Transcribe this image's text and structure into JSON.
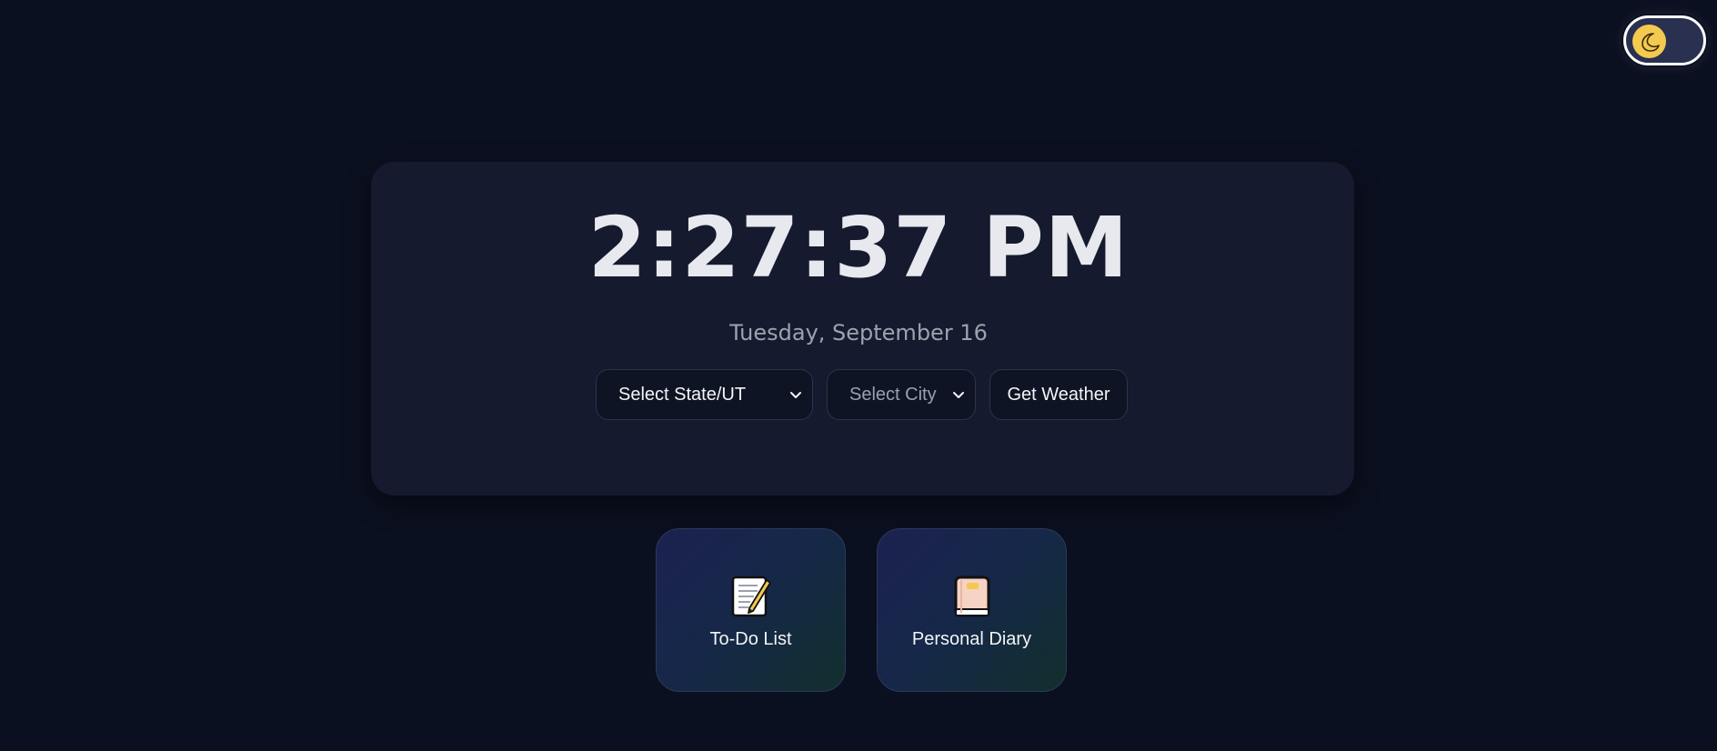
{
  "theme_toggle": {
    "icon": "moon-icon",
    "knob_color": "#f4c950",
    "state": "dark"
  },
  "clock": {
    "time": "2:27:37 PM",
    "date": "Tuesday, September 16"
  },
  "weather": {
    "state_select": {
      "value": "Select State/UT"
    },
    "city_select": {
      "value": "Select City"
    },
    "button_label": "Get Weather"
  },
  "apps": [
    {
      "label": "To-Do List",
      "icon": "memo-icon"
    },
    {
      "label": "Personal Diary",
      "icon": "notebook-icon"
    }
  ],
  "colors": {
    "background": "#0b1020",
    "card": "#151a2e",
    "text": "#e7e9ef",
    "muted": "#9ca3af",
    "accent": "#f4c950"
  }
}
